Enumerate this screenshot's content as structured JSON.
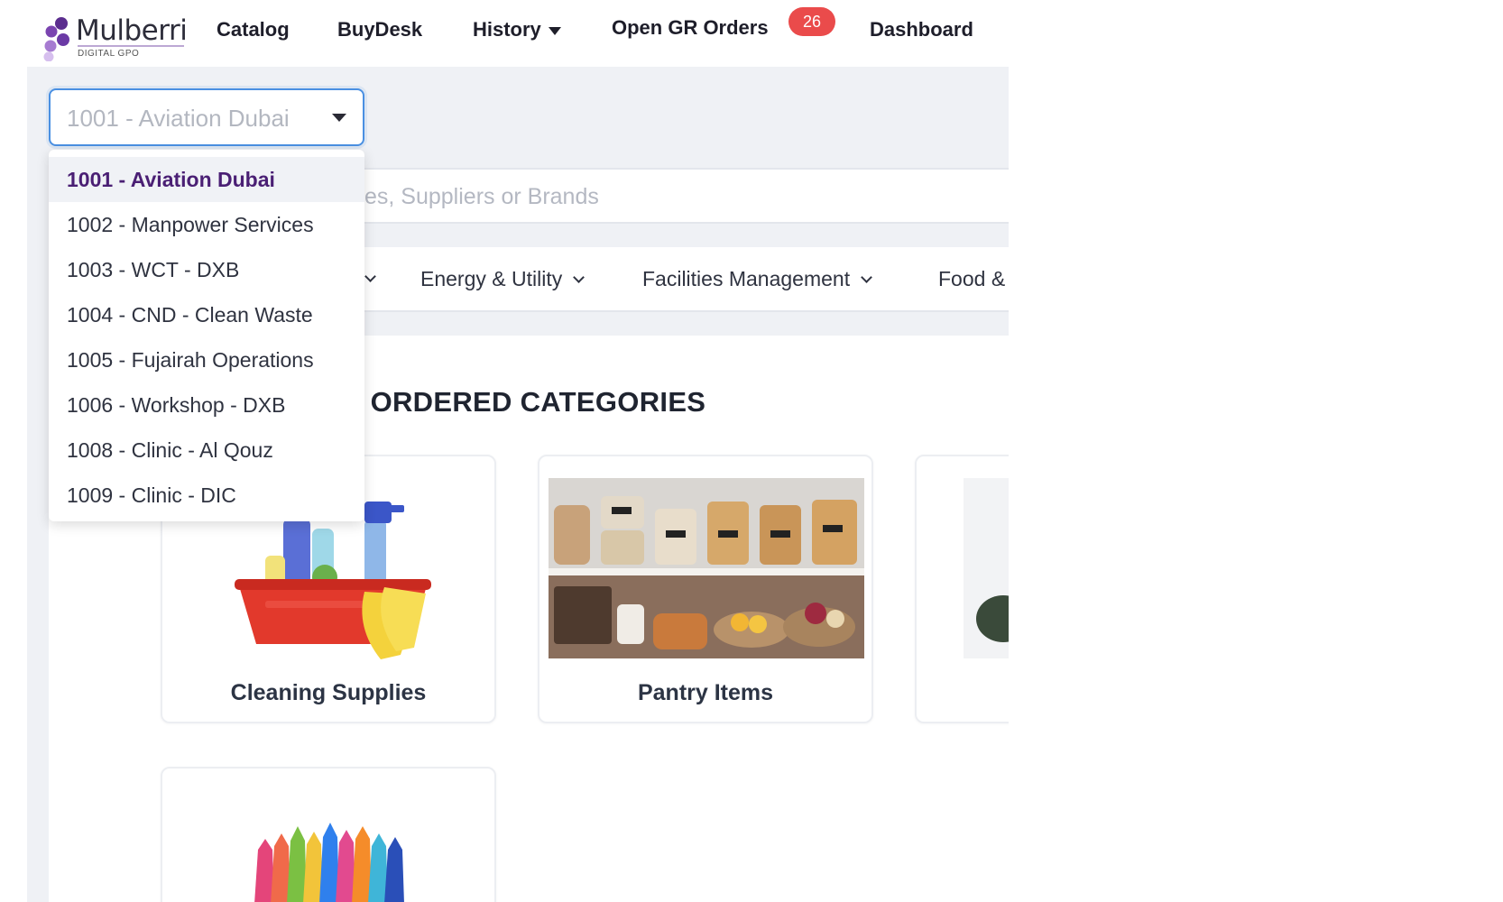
{
  "header": {
    "logo_text": "Mulberri",
    "logo_subtext": "DIGITAL GPO",
    "nav": {
      "catalog": "Catalog",
      "buydesk": "BuyDesk",
      "history": "History",
      "open_gr_orders": "Open GR Orders",
      "open_gr_count": "26",
      "dashboard": "Dashboard"
    }
  },
  "site_select": {
    "value": "1001 - Aviation Dubai",
    "options": [
      "1001 - Aviation Dubai",
      "1002 - Manpower Services",
      "1003 - WCT - DXB",
      "1004 - CND - Clean Waste",
      "1005 - Fujairah Operations",
      "1006 - Workshop - DXB",
      "1008 - Clinic - Al Qouz",
      "1009 - Clinic - DIC"
    ]
  },
  "search": {
    "placeholder_visible": "es, Suppliers or Brands"
  },
  "categories": {
    "energy": "Energy & Utility",
    "facilities": "Facilities Management",
    "food": "Food &"
  },
  "section": {
    "title_visible": "' ORDERED CATEGORIES"
  },
  "cards": {
    "cleaning": "Cleaning Supplies",
    "pantry": "Pantry Items"
  },
  "colors": {
    "brand_purple": "#4a1f74",
    "badge_red": "#ea4b4b",
    "select_border": "#4a90e2",
    "frame_gray": "#eff1f5"
  }
}
